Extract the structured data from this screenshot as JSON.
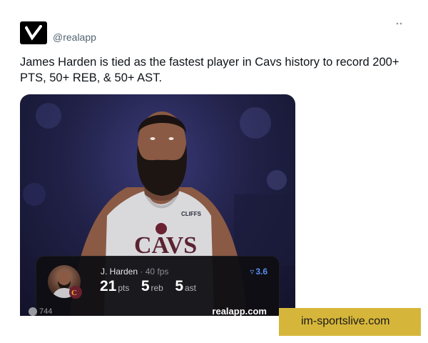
{
  "header": {
    "handle": "@realapp",
    "logo_icon": "realapp-logo-icon"
  },
  "tweet": {
    "text": "James Harden is tied as the fastest player in Cavs history to record 200+ PTS, 50+ REB, & 50+ AST."
  },
  "stat_card": {
    "name": "J. Harden",
    "fps": "· 40 fps",
    "rating": "3.6",
    "pts": "21",
    "pts_label": "pts",
    "reb": "5",
    "reb_label": "reb",
    "ast": "5",
    "ast_label": "ast"
  },
  "jersey": {
    "brand": "CLIFFS",
    "team": "CAVS"
  },
  "media_footer": {
    "views": "744",
    "site": "realapp.com"
  },
  "watermark": {
    "text": "im-sportslive.com"
  },
  "colors": {
    "accent": "#5b8def",
    "watermark_bg": "#d6b63a"
  }
}
